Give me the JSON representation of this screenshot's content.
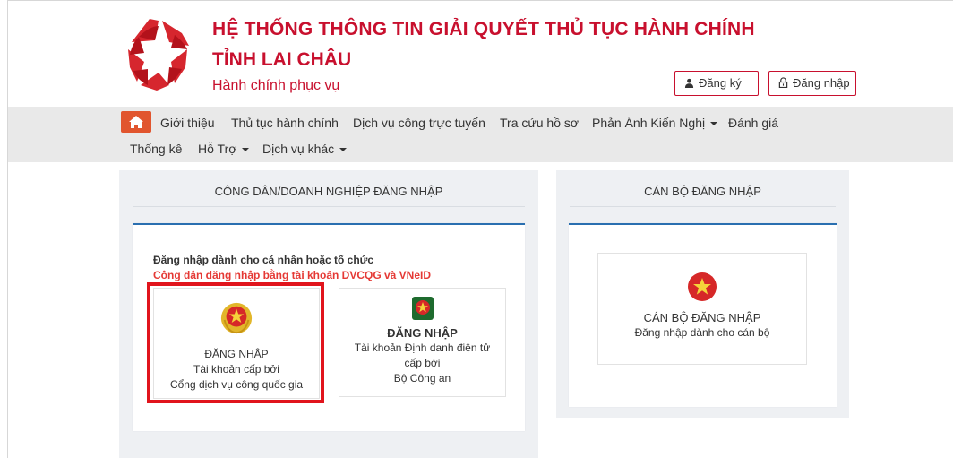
{
  "header": {
    "title_line1": "HỆ THỐNG THÔNG TIN GIẢI QUYẾT THỦ TỤC HÀNH CHÍNH",
    "title_line2": "TỈNH LAI CHÂU",
    "tagline": "Hành chính phục vụ",
    "register_label": "Đăng ký",
    "login_label": "Đăng nhập",
    "brand_color": "#c8102e"
  },
  "nav": {
    "items": [
      {
        "label": "Giới thiệu"
      },
      {
        "label": "Thủ tục hành chính"
      },
      {
        "label": "Dịch vụ công trực tuyến"
      },
      {
        "label": "Tra cứu hồ sơ"
      },
      {
        "label": "Phản Ánh Kiến Nghị"
      },
      {
        "label": "Đánh giá"
      },
      {
        "label": "Thống kê"
      },
      {
        "label": "Hỗ Trợ"
      },
      {
        "label": "Dịch vụ khác"
      }
    ]
  },
  "citizen_panel": {
    "heading": "CÔNG DÂN/DOANH NGHIỆP ĐĂNG NHẬP",
    "desc": "Đăng nhập dành cho cá nhân hoặc tổ chức",
    "note": "Công dân đăng nhập bằng tài khoản DVCQG và VNeID",
    "option_dvc": {
      "line1": "ĐĂNG NHẬP",
      "line2": "Tài khoản cấp bởi",
      "line3": "Cổng dịch vụ công quốc gia"
    },
    "option_vneid": {
      "line1": "ĐĂNG NHẬP",
      "line2": "Tài khoản Định danh điện tử",
      "line3": "cấp bởi",
      "line4": "Bộ Công an"
    }
  },
  "staff_panel": {
    "heading": "CÁN BỘ ĐĂNG NHẬP",
    "option": {
      "line1": "CÁN BỘ ĐĂNG NHẬP",
      "line2": "Đăng nhập dành cho cán bộ"
    }
  },
  "colors": {
    "accent": "#c8102e",
    "nav_bg": "#e9e9e9",
    "home": "#e1552e",
    "highlight": "#e1141c",
    "card_top": "#2a6fb0"
  }
}
